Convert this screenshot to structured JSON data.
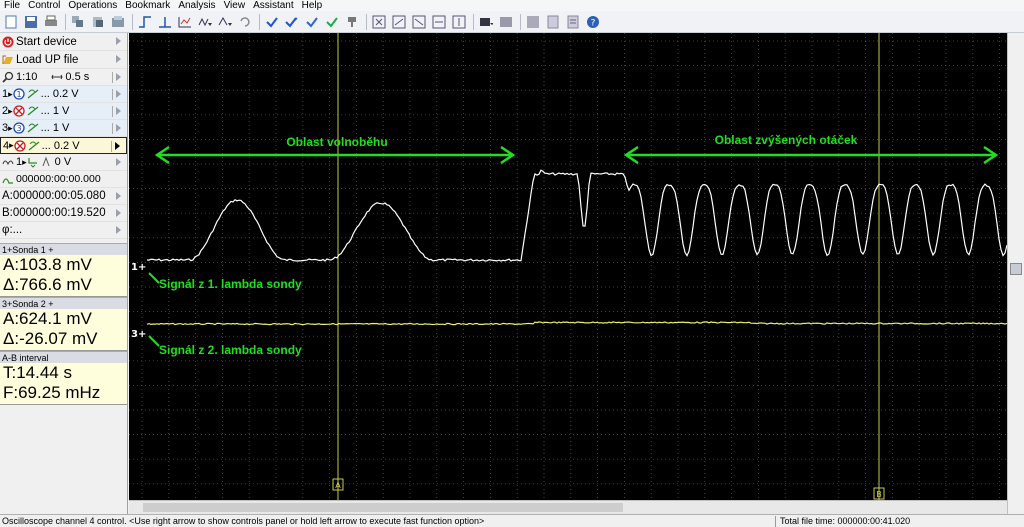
{
  "menu": [
    "File",
    "Control",
    "Operations",
    "Bookmark",
    "Analysis",
    "View",
    "Assistant",
    "Help"
  ],
  "panel": {
    "start_device": "Start device",
    "load_file": "Load UP file",
    "zoom": "1:10",
    "timebase": "0.5 s",
    "channels": [
      {
        "num": "1",
        "scale": "... 0.2 V",
        "enabled": true
      },
      {
        "num": "2",
        "scale": "... 1 V",
        "enabled": false
      },
      {
        "num": "3",
        "scale": "... 1 V",
        "enabled": true
      },
      {
        "num": "4",
        "scale": "... 0.2 V",
        "enabled": false
      }
    ],
    "trigger_channel": "1",
    "trigger_level": "0 V",
    "trigger_time": "000000:00:00.000",
    "cursor_a": "A:000000:00:05.080",
    "cursor_b": "B:000000:00:19.520",
    "phi": "φ:..."
  },
  "measurements": {
    "probe1": {
      "title": "1+Sonda 1 +",
      "a": "A:103.8 mV",
      "delta": "Δ:766.6 mV"
    },
    "probe2": {
      "title": "3+Sonda 2 +",
      "a": "A:624.1 mV",
      "delta": "Δ:-26.07 mV"
    },
    "interval": {
      "title": "A-B interval",
      "t": "T:14.44 s",
      "f": "F:69.25 mHz"
    }
  },
  "scope": {
    "annot_idle": "Oblast volnoběhu",
    "annot_high": "Oblast zvýšených otáček",
    "label_sig1": "Signál z 1. lambda sondy",
    "label_sig2": "Signál z 2. lambda sondy",
    "ch1_marker": "1+",
    "ch3_marker": "3+",
    "cursor_a_label": "A",
    "cursor_b_label": "B",
    "colors": {
      "background": "#000000",
      "grid": "#5a5a5a",
      "ch1": "#ffffff",
      "ch3": "#f0ee70",
      "annotation": "#22dd22",
      "cursor": "#c8c84a"
    }
  },
  "status": {
    "message": "Oscilloscope channel 4 control. <Use right arrow to show controls panel or hold left arrow to execute fast function option>",
    "file_time": "Total file time: 000000:00:41.020"
  }
}
